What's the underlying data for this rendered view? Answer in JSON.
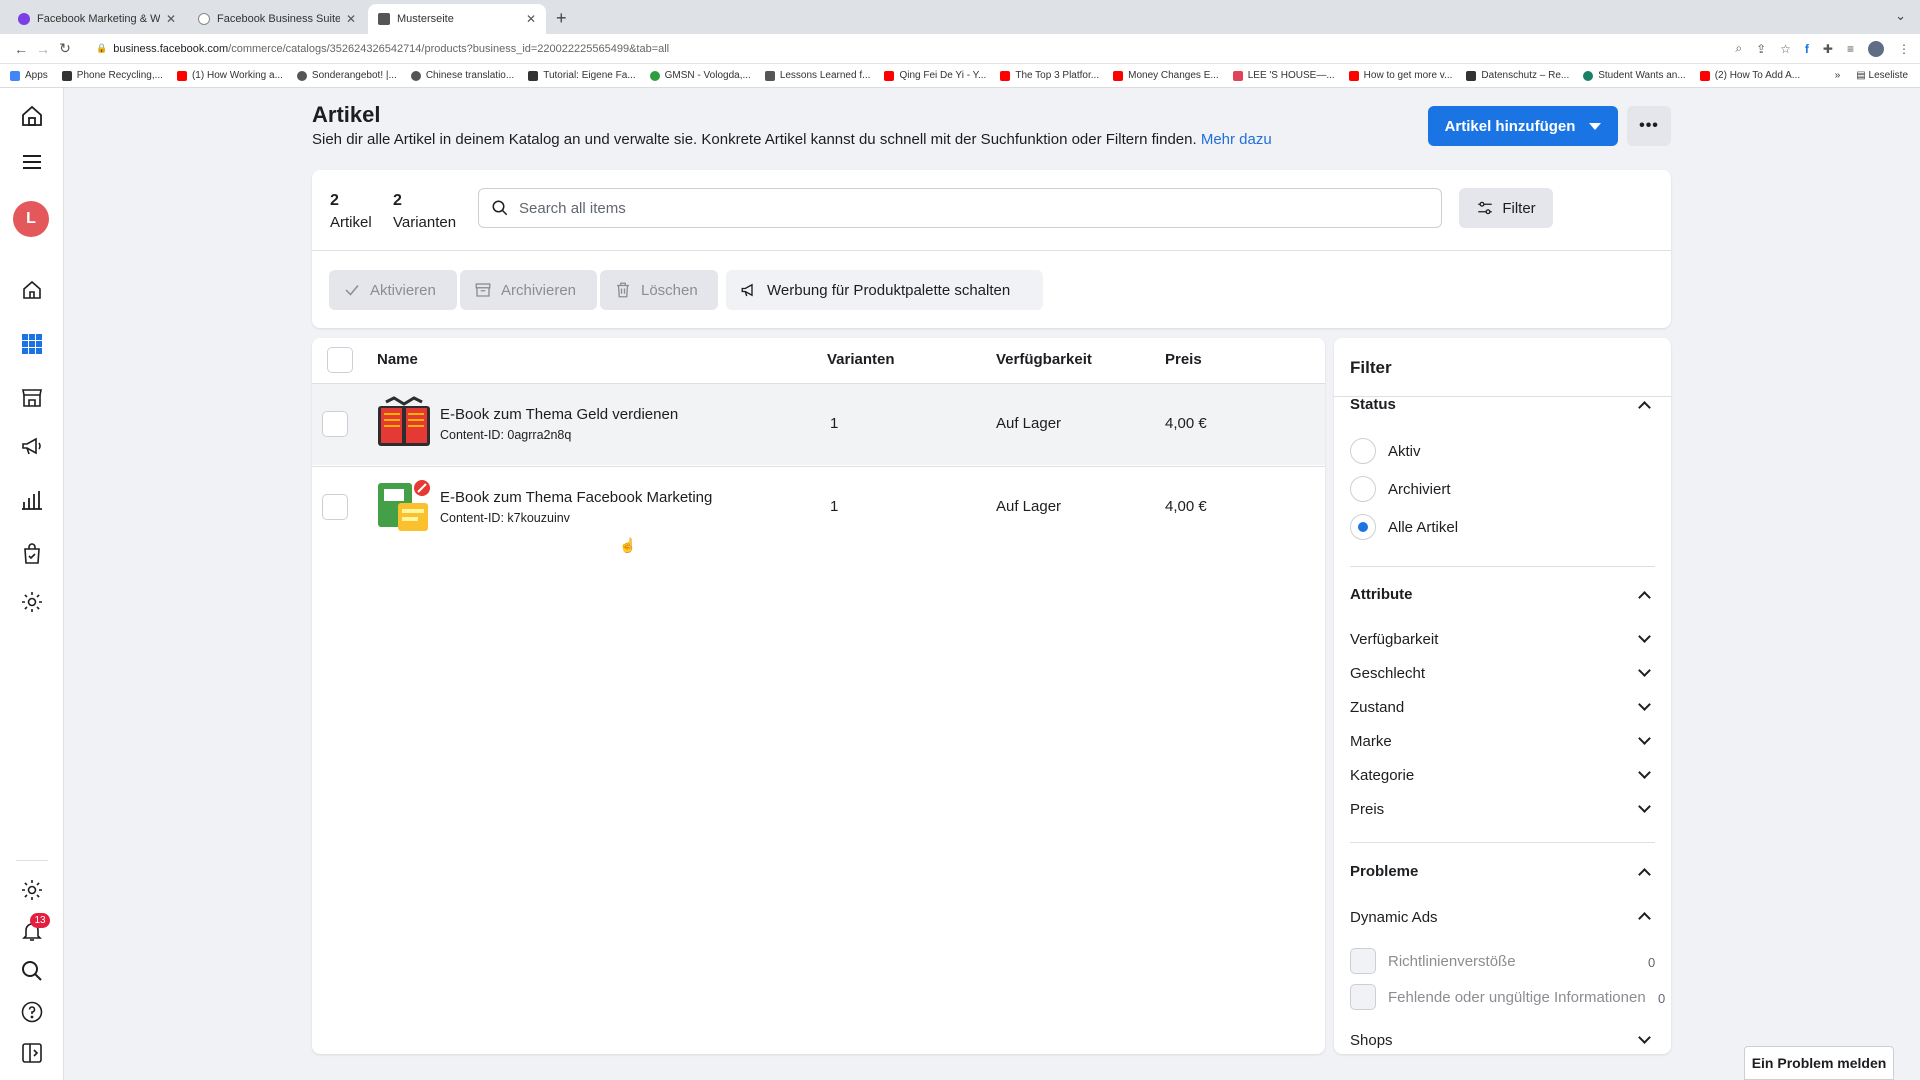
{
  "browser": {
    "tabs": [
      {
        "title": "Facebook Marketing & Werbea",
        "color": "#7b3fe4"
      },
      {
        "title": "Facebook Business Suite",
        "color": "#888888"
      },
      {
        "title": "Musterseite",
        "color": "#555555"
      }
    ],
    "url_host": "business.facebook.com",
    "url_path": "/commerce/catalogs/352624326542714/products?business_id=220022225565499&tab=all",
    "bookmarks": [
      {
        "label": "Apps",
        "color": "#4285f4"
      },
      {
        "label": "Phone Recycling,...",
        "color": "#333333"
      },
      {
        "label": "(1) How Working a...",
        "color": "#ff0000"
      },
      {
        "label": "Sonderangebot! |...",
        "color": "#555555"
      },
      {
        "label": "Chinese translatio...",
        "color": "#555555"
      },
      {
        "label": "Tutorial: Eigene Fa...",
        "color": "#333333"
      },
      {
        "label": "GMSN - Vologda,...",
        "color": "#2e9e3e"
      },
      {
        "label": "Lessons Learned f...",
        "color": "#555555"
      },
      {
        "label": "Qing Fei De Yi - Y...",
        "color": "#ff0000"
      },
      {
        "label": "The Top 3 Platfor...",
        "color": "#ff0000"
      },
      {
        "label": "Money Changes E...",
        "color": "#ff0000"
      },
      {
        "label": "LEE 'S HOUSE—...",
        "color": "#e0435b"
      },
      {
        "label": "How to get more v...",
        "color": "#ff0000"
      },
      {
        "label": "Datenschutz – Re...",
        "color": "#333333"
      },
      {
        "label": "Student Wants an...",
        "color": "#1a7f64"
      },
      {
        "label": "(2) How To Add A...",
        "color": "#ff0000"
      }
    ],
    "reading_list": "Leseliste"
  },
  "sidebar": {
    "avatar_letter": "L",
    "notification_count": "13"
  },
  "header": {
    "title": "Artikel",
    "description": "Sieh dir alle Artikel in deinem Katalog an und verwalte sie. Konkrete Artikel kannst du schnell mit der Suchfunktion oder Filtern finden.",
    "more_link": "Mehr dazu",
    "add_button": "Artikel hinzufügen"
  },
  "summary": {
    "items_count": "2",
    "items_label": "Artikel",
    "variants_count": "2",
    "variants_label": "Varianten"
  },
  "search": {
    "placeholder": "Search all items"
  },
  "filter_button": "Filter",
  "actions": {
    "activate": "Aktivieren",
    "archive": "Archivieren",
    "delete": "Löschen",
    "advertise": "Werbung für Produktpalette schalten"
  },
  "table": {
    "columns": {
      "name": "Name",
      "variants": "Varianten",
      "availability": "Verfügbarkeit",
      "price": "Preis"
    },
    "rows": [
      {
        "name": "E-Book zum Thema Geld verdienen",
        "content_id": "Content-ID: 0agrra2n8q",
        "variants": "1",
        "availability": "Auf Lager",
        "price": "4,00 €"
      },
      {
        "name": "E-Book zum Thema Facebook Marketing",
        "content_id": "Content-ID: k7kouzuinv",
        "variants": "1",
        "availability": "Auf Lager",
        "price": "4,00 €"
      }
    ]
  },
  "filter_panel": {
    "title": "Filter",
    "status": {
      "title": "Status",
      "options": [
        "Aktiv",
        "Archiviert",
        "Alle Artikel"
      ],
      "selected": "Alle Artikel"
    },
    "attributes": {
      "title": "Attribute",
      "items": [
        "Verfügbarkeit",
        "Geschlecht",
        "Zustand",
        "Marke",
        "Kategorie",
        "Preis"
      ]
    },
    "problems": {
      "title": "Probleme",
      "dynamic_ads": "Dynamic Ads",
      "checks": [
        {
          "label": "Richtlinienverstöße",
          "count": "0"
        },
        {
          "label": "Fehlende oder ungültige Informationen",
          "count": "0"
        }
      ]
    },
    "shops": "Shops"
  },
  "report_button": "Ein Problem melden",
  "colors": {
    "accent": "#1b74e4",
    "badge": "#e41e3f",
    "avatar": "#e4585b"
  }
}
